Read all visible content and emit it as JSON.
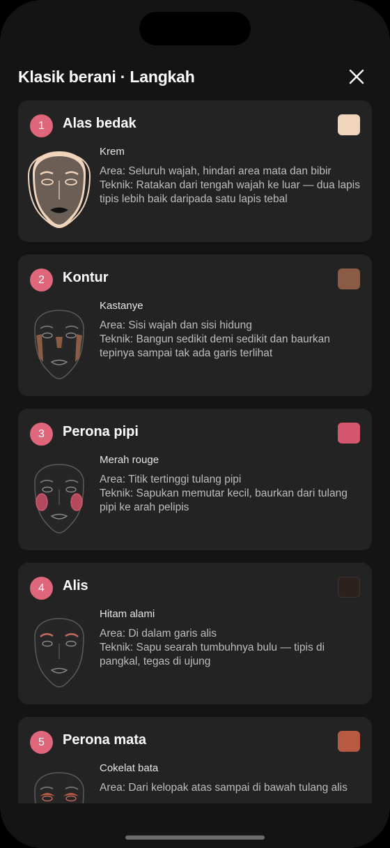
{
  "header": {
    "title": "Klasik berani · Langkah"
  },
  "steps": [
    {
      "number": "1",
      "title": "Alas bedak",
      "color_name": "Krem",
      "area": "Area: Seluruh wajah, hindari area mata dan bibir",
      "technique": "Teknik: Ratakan dari tengah wajah ke luar — dua lapis tipis lebih baik daripada satu lapis tebal",
      "swatch_color": "#f0d5bc",
      "face_icon": "face-foundation-icon"
    },
    {
      "number": "2",
      "title": "Kontur",
      "color_name": "Kastanye",
      "area": "Area: Sisi wajah dan sisi hidung",
      "technique": "Teknik: Bangun sedikit demi sedikit dan baurkan tepinya sampai tak ada garis terlihat",
      "swatch_color": "#8a5c45",
      "face_icon": "face-contour-icon"
    },
    {
      "number": "3",
      "title": "Perona pipi",
      "color_name": "Merah rouge",
      "area": "Area: Titik tertinggi tulang pipi",
      "technique": "Teknik: Sapukan memutar kecil, baurkan dari tulang pipi ke arah pelipis",
      "swatch_color": "#d4576e",
      "face_icon": "face-blush-icon"
    },
    {
      "number": "4",
      "title": "Alis",
      "color_name": "Hitam alami",
      "area": "Area: Di dalam garis alis",
      "technique": "Teknik: Sapu searah tumbuhnya bulu — tipis di pangkal, tegas di ujung",
      "swatch_color": "#2c211e",
      "face_icon": "face-brow-icon"
    },
    {
      "number": "5",
      "title": "Perona mata",
      "color_name": "Cokelat bata",
      "area": "Area: Dari kelopak atas sampai di bawah tulang alis",
      "technique": "",
      "swatch_color": "#b85a42",
      "face_icon": "face-eyeshadow-icon"
    }
  ],
  "colors": {
    "accent": "#e0677b",
    "card_bg": "#232323",
    "screen_bg": "#141414"
  },
  "icons": {
    "close": "close-icon"
  }
}
